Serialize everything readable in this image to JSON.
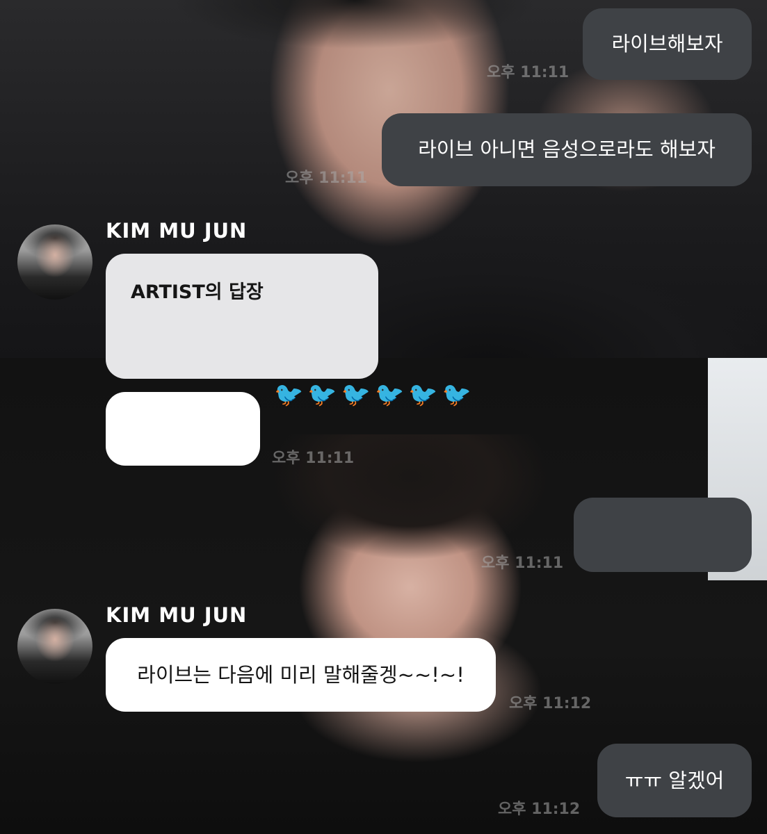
{
  "chat": {
    "messages": [
      {
        "side": "right",
        "text": "라이브해보자",
        "time": "오후 11:11"
      },
      {
        "side": "right",
        "text": "라이브 아니면 음성으로라도 해보자",
        "time": "오후 11:11"
      },
      {
        "side": "left",
        "sender": "KIM MU JUN",
        "reply_title": "ARTIST의 답장"
      },
      {
        "side": "left",
        "text": "",
        "time": "오후 11:11"
      },
      {
        "side": "right",
        "text": "",
        "time": "오후 11:11"
      },
      {
        "side": "left",
        "sender": "KIM MU JUN",
        "text": "라이브는 다음에 미리 말해줄겡~~!~!",
        "time": "오후 11:12"
      },
      {
        "side": "right",
        "text": "ㅠㅠ 알겠어",
        "time": "오후 11:12"
      }
    ]
  },
  "decoration": {
    "icon": "bird-icon"
  },
  "colors": {
    "outgoing_bubble": "#3f4246",
    "incoming_bubble": "#ffffff",
    "reply_card": "#e6e6e8"
  }
}
